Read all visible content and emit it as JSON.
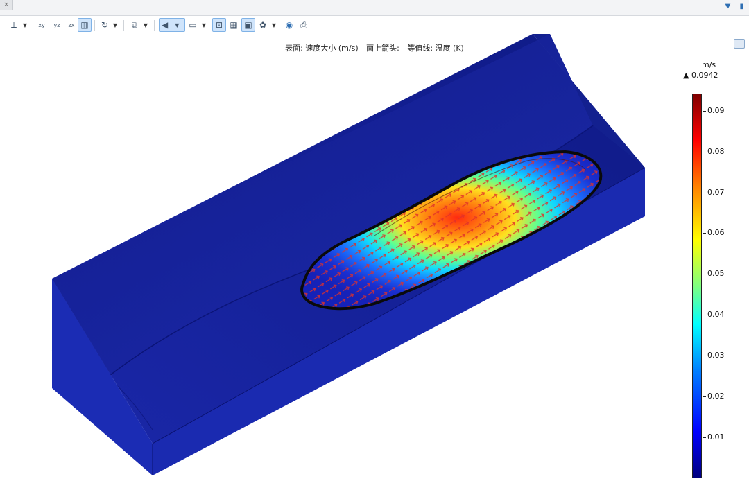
{
  "window": {
    "tab_stub": "×",
    "controls": [
      "▼",
      "▮"
    ]
  },
  "toolbar": {
    "buttons": [
      {
        "name": "axis-orientation-icon",
        "glyph": "⟂"
      },
      {
        "name": "xy-view-icon",
        "glyph": "xy"
      },
      {
        "name": "yz-view-icon",
        "glyph": "yz"
      },
      {
        "name": "zx-view-icon",
        "glyph": "zx"
      },
      {
        "name": "scene-light-icon",
        "glyph": "▥"
      },
      {
        "name": "rotate-icon",
        "glyph": "↻"
      },
      {
        "name": "copy-icon",
        "glyph": "⧉"
      },
      {
        "name": "go-back-icon",
        "glyph": "◀"
      },
      {
        "name": "layers-icon",
        "glyph": "▭"
      },
      {
        "name": "zoom-box-icon",
        "glyph": "⊡"
      },
      {
        "name": "grid-icon",
        "glyph": "▦"
      },
      {
        "name": "zoom-extents-icon",
        "glyph": "▣"
      },
      {
        "name": "settings-wheel-icon",
        "glyph": "✿"
      },
      {
        "name": "camera-icon",
        "glyph": "◉"
      },
      {
        "name": "print-icon",
        "glyph": "⎙"
      }
    ]
  },
  "plot": {
    "title_surface": "表面: 速度大小 (m/s)",
    "title_arrows": "面上箭头:",
    "title_contour": "等值线: 温度 (K)"
  },
  "colorbar": {
    "unit": "m/s",
    "max_label": "▲ 0.0942",
    "ticks": [
      "0.09",
      "0.08",
      "0.07",
      "0.06",
      "0.05",
      "0.04",
      "0.03",
      "0.02",
      "0.01"
    ],
    "tick_values": [
      0.09,
      0.08,
      0.07,
      0.06,
      0.05,
      0.04,
      0.03,
      0.02,
      0.01
    ],
    "range": [
      0.0,
      0.0942
    ]
  },
  "colors": {
    "block_top": "#141f9a",
    "block_front": "#1a2bb4",
    "arrow": "#e0302a",
    "contour": "#0a0a0a",
    "toolbar_active": "#cfe4fb"
  }
}
